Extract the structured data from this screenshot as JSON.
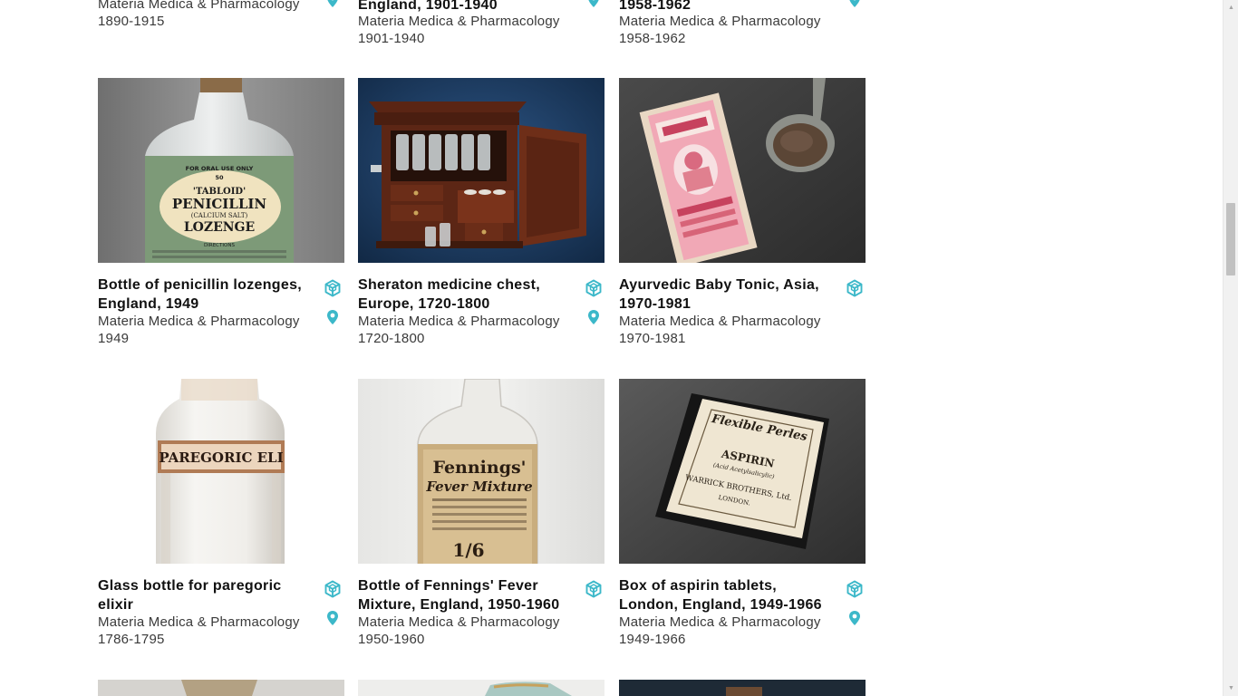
{
  "colors": {
    "accent": "#3cb8c9",
    "scrollbar_track": "#f1f1f1",
    "scrollbar_thumb": "#c1c1c1"
  },
  "icons": {
    "model": "3d-model-icon",
    "location": "location-pin-icon"
  },
  "rows": [
    [
      {
        "title_lines": [
          "",
          ""
        ],
        "category": "Materia Medica & Pharmacology",
        "date": "1890-1915",
        "has_model": false,
        "has_location": true,
        "image": "item-image"
      },
      {
        "title_lines": [
          "",
          "England, 1901-1940"
        ],
        "category": "Materia Medica & Pharmacology",
        "date": "1901-1940",
        "has_model": false,
        "has_location": true,
        "image": "item-image"
      },
      {
        "title_lines": [
          "",
          "1958-1962"
        ],
        "category": "Materia Medica & Pharmacology",
        "date": "1958-1962",
        "has_model": false,
        "has_location": true,
        "image": "item-image"
      }
    ],
    [
      {
        "title_lines": [
          "Bottle of penicillin lozenges,",
          "England, 1949"
        ],
        "category": "Materia Medica & Pharmacology",
        "date": "1949",
        "has_model": true,
        "has_location": true,
        "image": "penicillin-lozenges-bottle"
      },
      {
        "title_lines": [
          "Sheraton medicine chest,",
          "Europe, 1720-1800"
        ],
        "category": "Materia Medica & Pharmacology",
        "date": "1720-1800",
        "has_model": true,
        "has_location": true,
        "image": "sheraton-medicine-chest"
      },
      {
        "title_lines": [
          "Ayurvedic Baby Tonic, Asia,",
          "1970-1981"
        ],
        "category": "Materia Medica & Pharmacology",
        "date": "1970-1981",
        "has_model": true,
        "has_location": false,
        "image": "ayurvedic-baby-tonic"
      }
    ],
    [
      {
        "title_lines": [
          "Glass bottle for paregoric",
          "elixir"
        ],
        "category": "Materia Medica & Pharmacology",
        "date": "1786-1795",
        "has_model": true,
        "has_location": true,
        "image": "paregoric-elixir-bottle"
      },
      {
        "title_lines": [
          "Bottle of Fennings' Fever",
          "Mixture, England, 1950-1960"
        ],
        "category": "Materia Medica & Pharmacology",
        "date": "1950-1960",
        "has_model": true,
        "has_location": false,
        "image": "fennings-fever-mixture"
      },
      {
        "title_lines": [
          "Box of aspirin tablets,",
          "London, England, 1949-1966"
        ],
        "category": "Materia Medica & Pharmacology",
        "date": "1949-1966",
        "has_model": true,
        "has_location": true,
        "image": "aspirin-tablets-box"
      }
    ],
    [
      {
        "title_lines": [
          "",
          ""
        ],
        "category": "",
        "date": "",
        "has_model": false,
        "has_location": false,
        "image": "item-image"
      },
      {
        "title_lines": [
          "",
          ""
        ],
        "category": "",
        "date": "",
        "has_model": false,
        "has_location": false,
        "image": "item-image"
      },
      {
        "title_lines": [
          "",
          ""
        ],
        "category": "",
        "date": "",
        "has_model": false,
        "has_location": false,
        "image": "item-image"
      }
    ]
  ],
  "image_labels": {
    "penicillin": {
      "line1": "FOR ORAL USE ONLY",
      "line2": "50",
      "line3": "'TABLOID'",
      "line4": "PENICILLIN",
      "line5": "(CALCIUM SALT)",
      "line6": "LOZENGE",
      "line7": "DIRECTIONS"
    },
    "paregoric": "PAREGORIC ELI",
    "fennings": {
      "line1": "Fennings'",
      "line2": "Fever Mixture",
      "line3": "1/6"
    },
    "aspirin": {
      "line1": "Flexible Perles",
      "line2": "ASPIRIN",
      "line3": "(Acid Acetylsalicylic)",
      "line4": "WARRICK BROTHERS, Ltd.",
      "line5": "LONDON."
    }
  }
}
